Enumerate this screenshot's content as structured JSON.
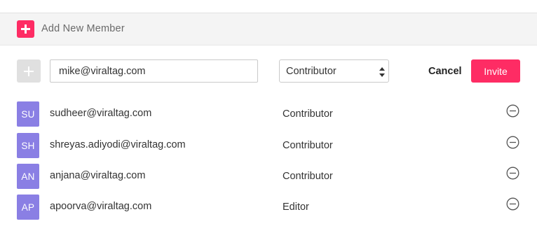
{
  "header": {
    "title": "Add New Member",
    "accent_color": "#fe2c64"
  },
  "invite_form": {
    "email_value": "mike@viraltag.com",
    "role_selected": "Contributor",
    "cancel_label": "Cancel",
    "invite_label": "Invite"
  },
  "members": [
    {
      "initials": "SU",
      "email": "sudheer@viraltag.com",
      "role": "Contributor"
    },
    {
      "initials": "SH",
      "email": "shreyas.adiyodi@viraltag.com",
      "role": "Contributor"
    },
    {
      "initials": "AN",
      "email": "anjana@viraltag.com",
      "role": "Contributor"
    },
    {
      "initials": "AP",
      "email": "apoorva@viraltag.com",
      "role": "Editor"
    }
  ],
  "icons": {
    "add": "plus-icon",
    "remove": "minus-circle-icon",
    "select": "chevron-updown-icon"
  },
  "colors": {
    "avatar_bg": "#8a7fe4",
    "invite_bg": "#fe2c64"
  }
}
